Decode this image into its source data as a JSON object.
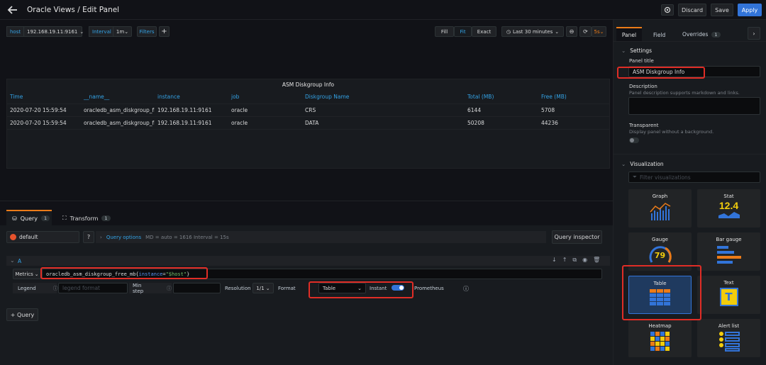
{
  "header": {
    "title": "Oracle Views / Edit Panel",
    "discard": "Discard",
    "save": "Save",
    "apply": "Apply"
  },
  "vars": {
    "host_label": "host",
    "host_value": "192.168.19.11:9161",
    "interval_label": "Interval",
    "interval_value": "1m",
    "filters_label": "Filters",
    "add": "+"
  },
  "viewctl": {
    "fill": "Fill",
    "fit": "Fit",
    "exact": "Exact",
    "time_range": "Last 30 minutes",
    "refresh": "5s"
  },
  "panel": {
    "title": "ASM Diskgroup Info",
    "columns": [
      "Time",
      "__name__",
      "instance",
      "job",
      "Diskgroup Name",
      "Total (MB)",
      "Free (MB)"
    ],
    "rows": [
      [
        "2020-07-20 15:59:54",
        "oracledb_asm_diskgroup_fr...",
        "192.168.19.11:9161",
        "oracle",
        "CRS",
        "6144",
        "5708"
      ],
      [
        "2020-07-20 15:59:54",
        "oracledb_asm_diskgroup_fr...",
        "192.168.19.11:9161",
        "oracle",
        "DATA",
        "50208",
        "44236"
      ]
    ]
  },
  "query_tabs": {
    "query": "Query",
    "query_count": "1",
    "transform": "Transform",
    "transform_count": "1"
  },
  "datasource": {
    "name": "default",
    "options": "Query options",
    "options_meta": "MD = auto = 1616   Interval = 15s",
    "inspector": "Query inspector"
  },
  "query": {
    "ref": "A",
    "metrics_label": "Metrics",
    "expr_prefix": "oracledb_asm_diskgroup_free_mb{",
    "expr_key": "instance",
    "expr_eq": "=",
    "expr_val": "\"$host\"",
    "expr_suffix": "}",
    "legend_label": "Legend",
    "legend_placeholder": "legend format",
    "minstep_label": "Min step",
    "resolution_label": "Resolution",
    "resolution_value": "1/1",
    "format_label": "Format",
    "format_value": "Table",
    "instant_label": "Instant",
    "datasource_name": "Prometheus"
  },
  "add_query": "+ Query",
  "sidebar": {
    "tabs": [
      "Panel",
      "Field",
      "Overrides"
    ],
    "overrides_count": "1",
    "settings_title": "Settings",
    "panel_title_label": "Panel title",
    "panel_title_value": "ASM Diskgroup Info",
    "description_label": "Description",
    "description_hint": "Panel description supports markdown and links.",
    "transparent_label": "Transparent",
    "transparent_hint": "Display panel without a background.",
    "visualization_title": "Visualization",
    "filter_placeholder": "Filter visualizations",
    "vis": [
      "Graph",
      "Stat",
      "Gauge",
      "Bar gauge",
      "Table",
      "Text",
      "Heatmap",
      "Alert list"
    ],
    "stat_value": "12.4",
    "gauge_value": "79"
  },
  "colors": {
    "accent": "#3274d9",
    "link": "#33a2e5",
    "highlight": "#e02d26",
    "orange": "#eb7b18",
    "yellow": "#f2cc0c"
  }
}
